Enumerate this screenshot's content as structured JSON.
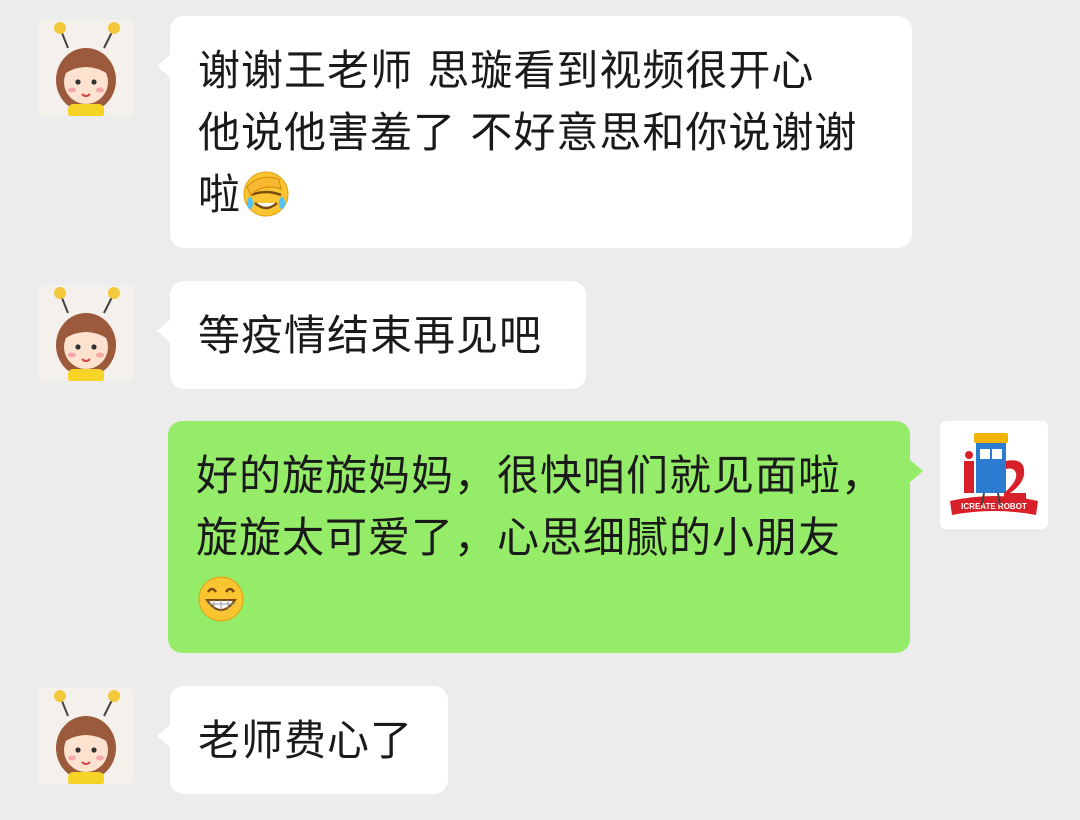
{
  "chat": {
    "messages": [
      {
        "sender": "incoming",
        "lines": [
          "谢谢王老师  思璇看到视频很开心",
          "他说他害羞了 不好意思和你说谢谢",
          "啦"
        ],
        "emoji": "face-palm-crying-emoji"
      },
      {
        "sender": "incoming",
        "lines": [
          "等疫情结束再见吧"
        ]
      },
      {
        "sender": "outgoing",
        "lines": [
          "好的旋旋妈妈，很快咱们就见面啦，",
          "旋旋太可爱了，心思细腻的小朋友"
        ],
        "emoji": "grinning-face-emoji"
      },
      {
        "sender": "incoming",
        "lines": [
          "老师费心了"
        ]
      }
    ]
  },
  "avatars": {
    "contact": "cartoon-girl-bee-antenna-avatar",
    "self": "icreate-robot-logo-avatar",
    "self_logo_text": "ICREATE ROBOT"
  },
  "colors": {
    "background": "#ececec",
    "incoming_bubble": "#ffffff",
    "outgoing_bubble": "#95ec69"
  }
}
